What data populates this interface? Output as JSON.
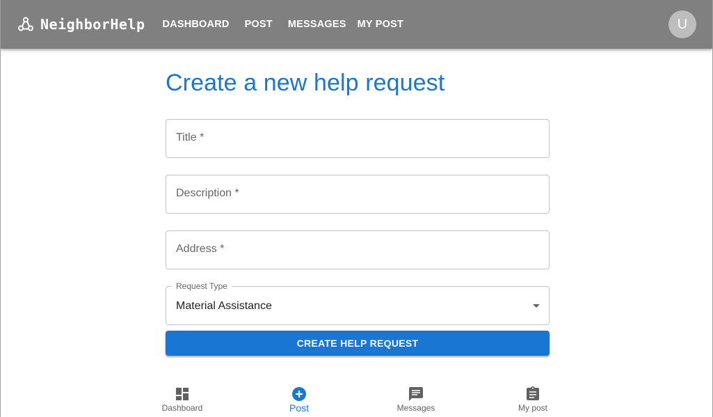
{
  "app": {
    "brand": "NeighborHelp",
    "colors": {
      "appbar": "#808080",
      "primary": "#1976d2",
      "avatar": "#bdbdbd"
    }
  },
  "nav": {
    "dashboard": "DASHBOARD",
    "post": "POST",
    "messages": "MESSAGES",
    "my_post": "MY POST"
  },
  "user": {
    "avatar_initial": "U"
  },
  "form": {
    "heading": "Create a new help request",
    "title_label": "Title *",
    "description_label": "Description *",
    "address_label": "Address *",
    "request_type_label": "Request Type",
    "request_type_value": "Material Assistance",
    "submit_label": "CREATE HELP REQUEST"
  },
  "bottom_nav": {
    "items": [
      {
        "label": "Dashboard",
        "icon": "dashboard-icon",
        "active": false
      },
      {
        "label": "Post",
        "icon": "add-circle-icon",
        "active": true
      },
      {
        "label": "Messages",
        "icon": "message-icon",
        "active": false
      },
      {
        "label": "My post",
        "icon": "assignment-icon",
        "active": false
      }
    ]
  }
}
